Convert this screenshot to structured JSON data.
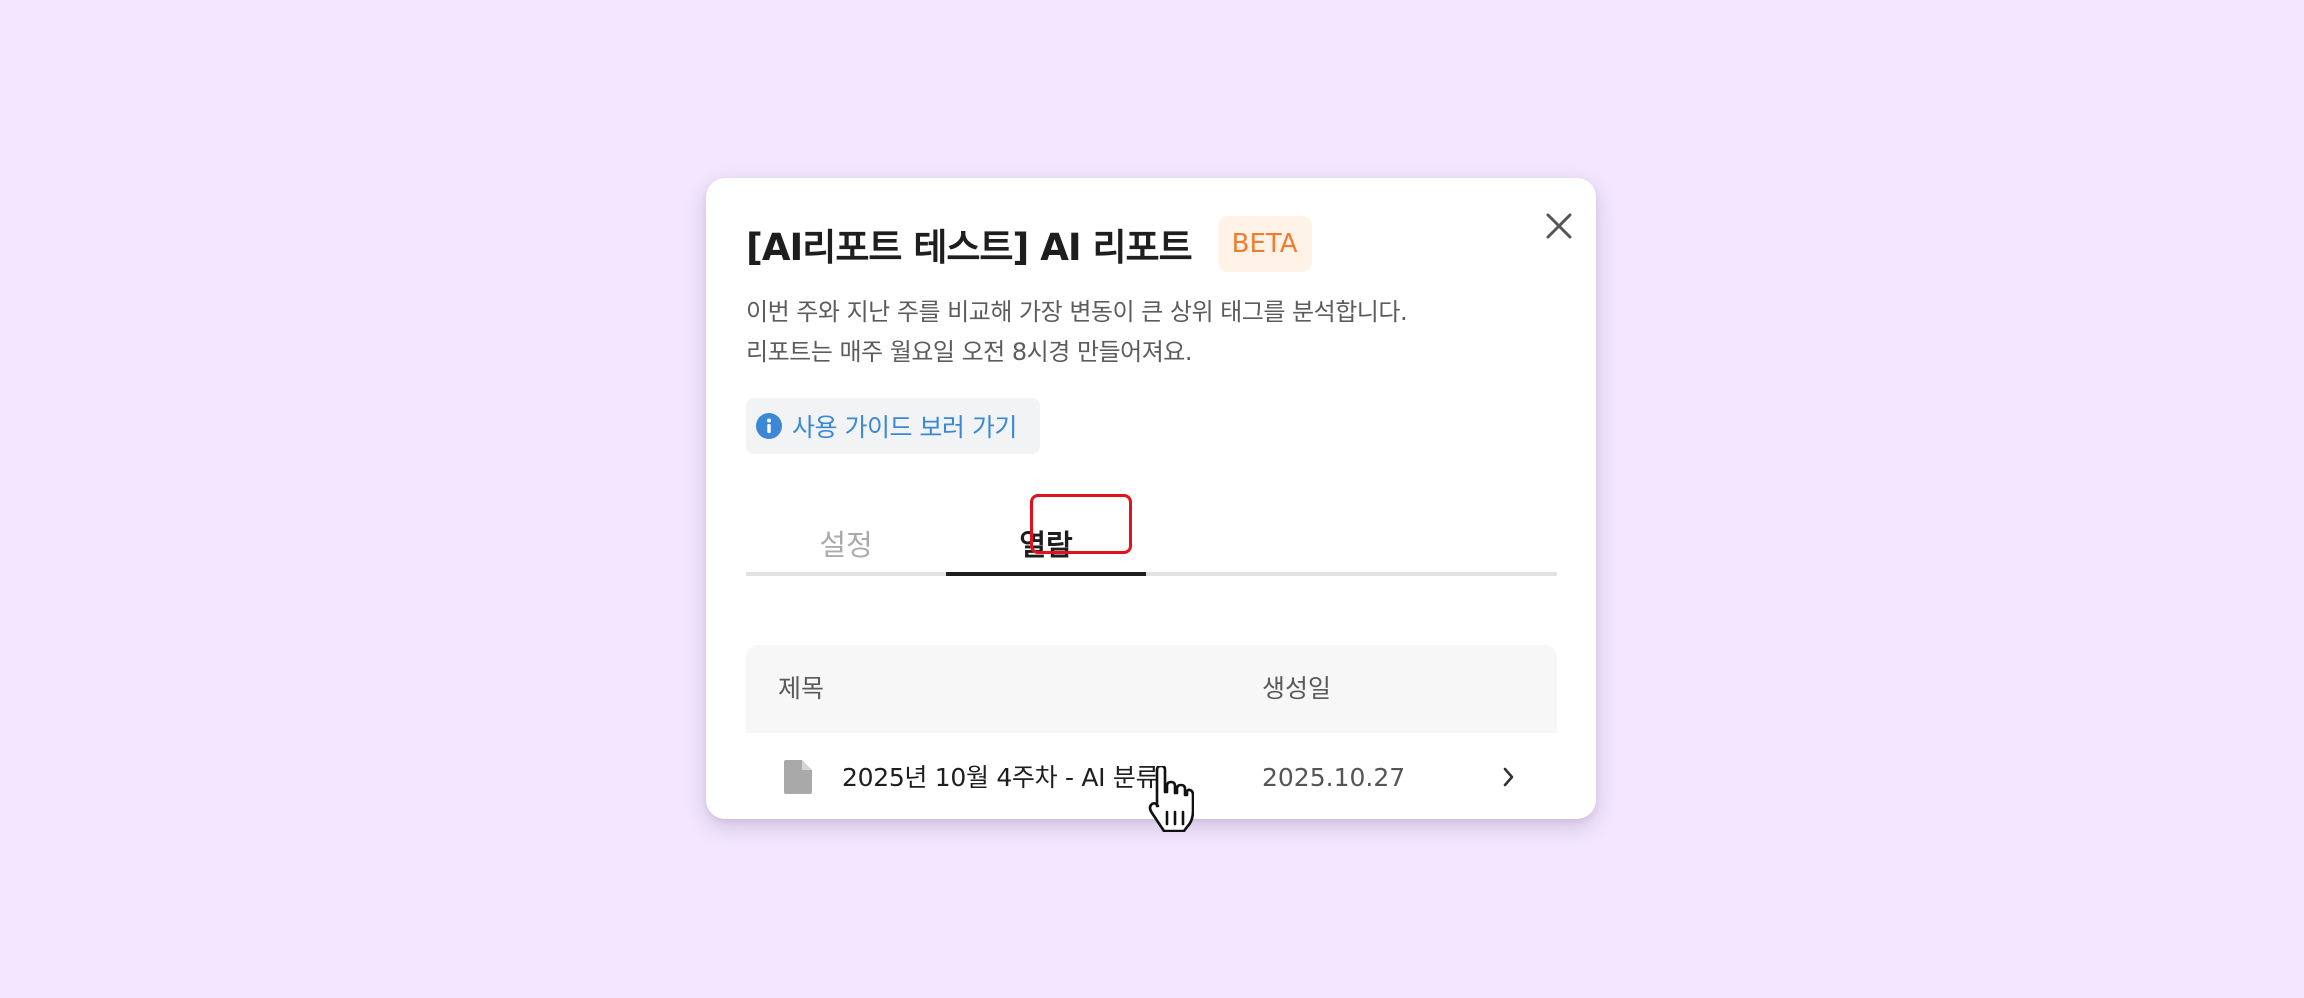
{
  "modal": {
    "title": "[AI리포트 테스트] AI 리포트",
    "badge": "BETA",
    "description_line1": "이번 주와 지난 주를 비교해 가장 변동이 큰 상위 태그를 분석합니다.",
    "description_line2": "리포트는 매주 월요일 오전 8시경 만들어져요.",
    "guide_link": "사용 가이드 보러 가기"
  },
  "tabs": [
    {
      "label": "설정",
      "active": false
    },
    {
      "label": "열람",
      "active": true
    }
  ],
  "table": {
    "headers": {
      "title": "제목",
      "date": "생성일"
    },
    "rows": [
      {
        "title": "2025년 10월 4주차 - AI 분류",
        "date": "2025.10.27"
      }
    ]
  },
  "colors": {
    "background": "#f3e6fe",
    "badge_text": "#f07d2f",
    "link": "#3b88d6",
    "highlight": "#e3111a"
  },
  "icons": {
    "close": "close-icon",
    "info": "info-icon",
    "document": "document-icon",
    "chevron": "chevron-right-icon",
    "cursor": "hand-pointer-cursor"
  }
}
